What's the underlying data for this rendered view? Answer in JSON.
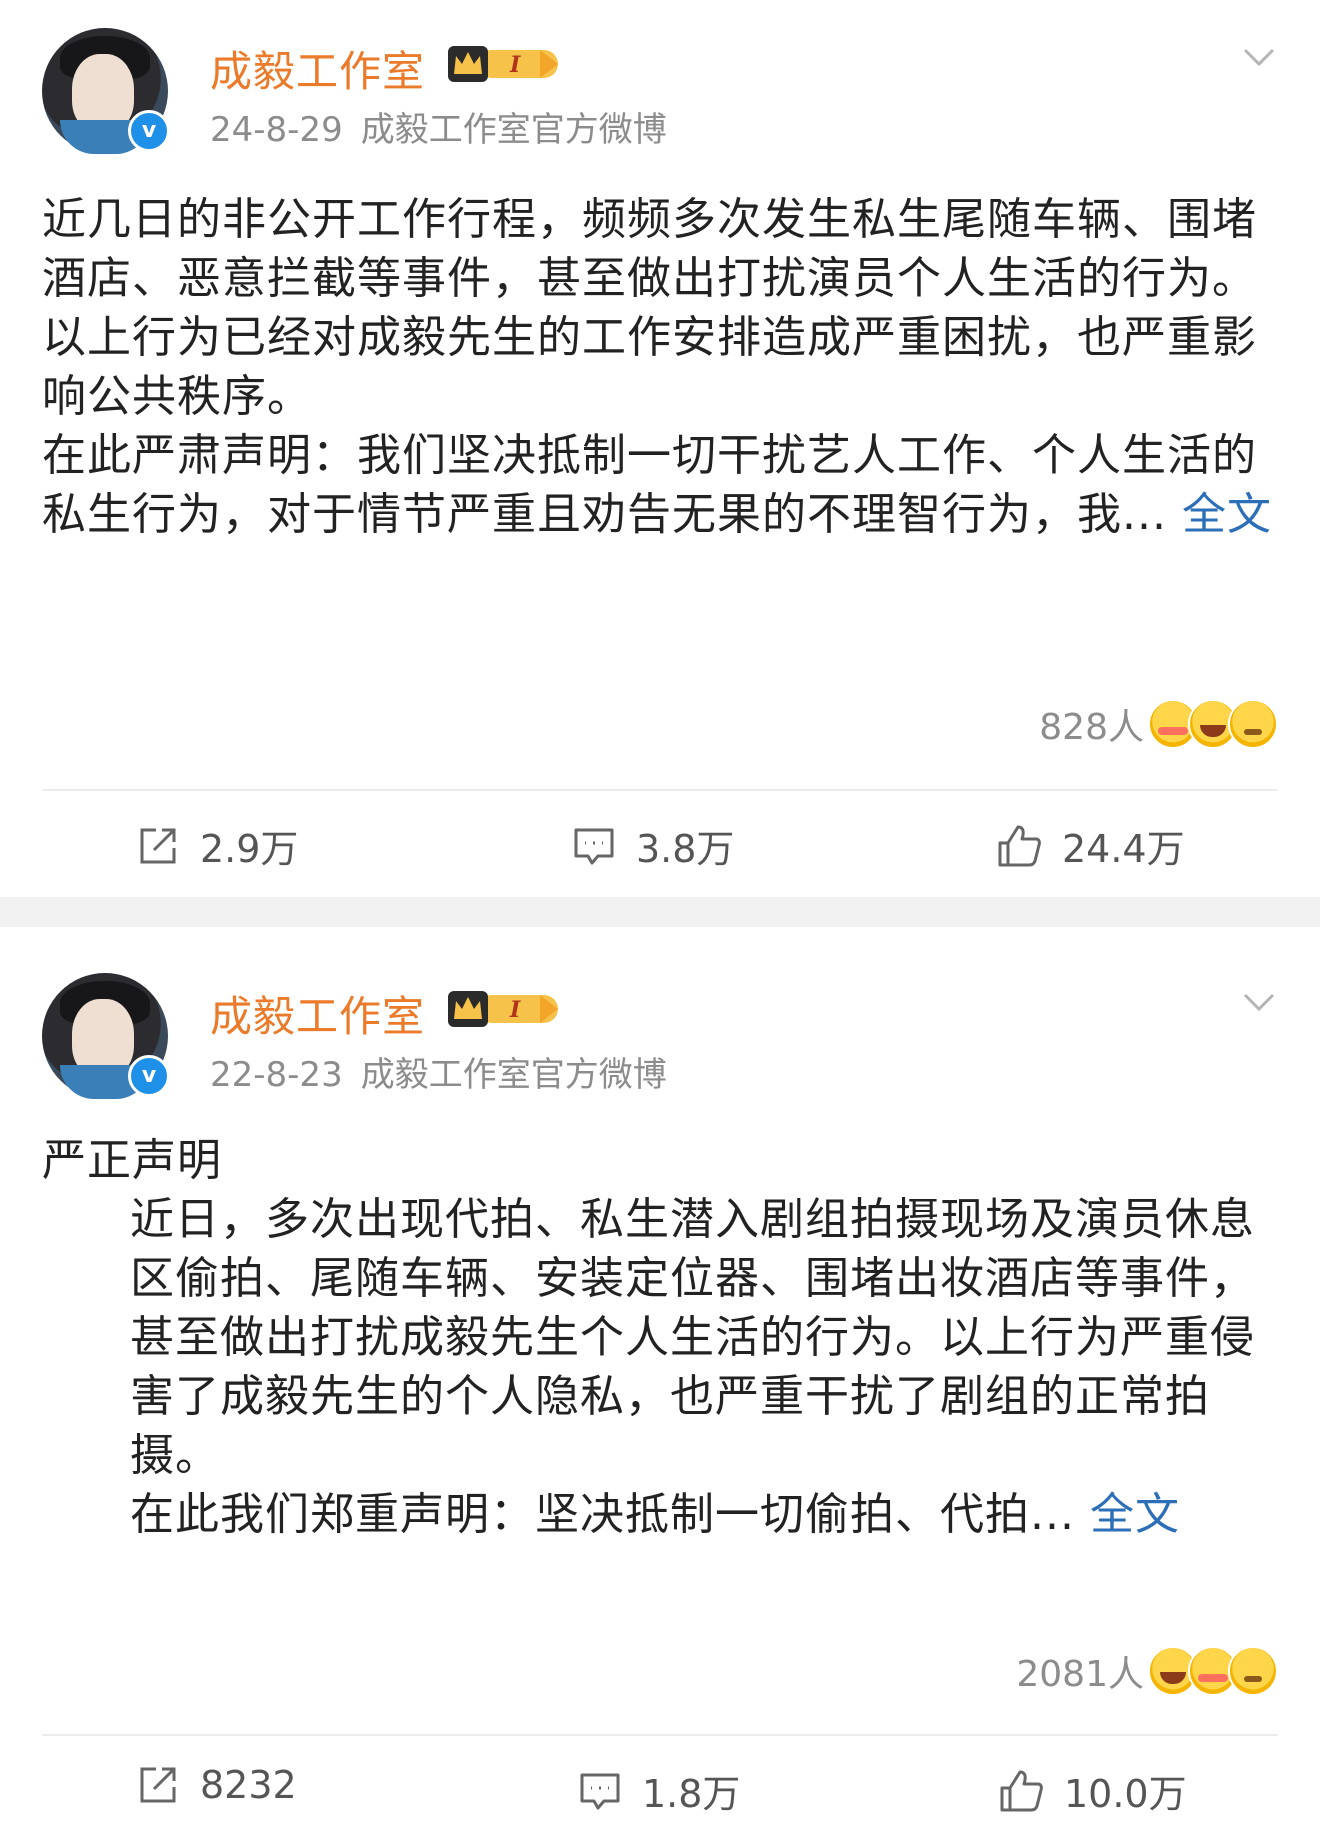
{
  "posts": [
    {
      "author": "成毅工作室",
      "date": "24-8-29",
      "source": "成毅工作室官方微博",
      "paragraphs": [
        "近几日的非公开工作行程，频频多次发生私生尾随车辆、围堵酒店、恶意拦截等事件，甚至做出打扰演员个人生活的行为。以上行为已经对成毅先生的工作安排造成严重困扰，也严重影响公共秩序。",
        "在此严肃声明：我们坚决抵制一切干扰艺人工作、个人生活的私生行为，对于情节严重且劝告无果的不理智行为，我..."
      ],
      "full_link": "全文",
      "reaction_count": "828人",
      "reposts": "2.9万",
      "comments": "3.8万",
      "likes": "24.4万"
    },
    {
      "author": "成毅工作室",
      "date": "22-8-23",
      "source": "成毅工作室官方微博",
      "heading": "严正声明",
      "paragraphs": [
        "近日，多次出现代拍、私生潜入剧组拍摄现场及演员休息区偷拍、尾随车辆、安装定位器、围堵出妆酒店等事件，甚至做出打扰成毅先生个人生活的行为。以上行为严重侵害了成毅先生的个人隐私，也严重干扰了剧组的正常拍摄。",
        "在此我们郑重声明：坚决抵制一切偷拍、代拍..."
      ],
      "full_link": "全文",
      "reaction_count": "2081人",
      "reposts": "8232",
      "comments": "1.8万",
      "likes": "10.0万"
    }
  ],
  "colors": {
    "name": "#eb7b2a",
    "link": "#2c6fb8",
    "meta": "#8c8c8c",
    "verified": "#1e90e8"
  },
  "icons": [
    "verified-badge-icon",
    "vip-crown-icon",
    "chevron-down-icon",
    "repost-icon",
    "comment-icon",
    "like-icon"
  ]
}
